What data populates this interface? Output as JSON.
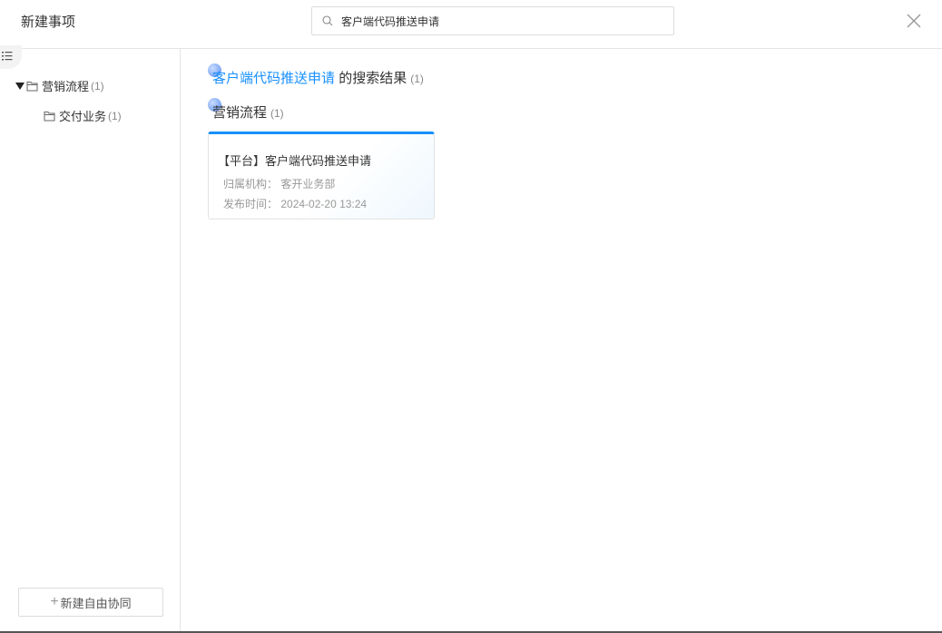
{
  "header": {
    "title": "新建事项",
    "search_value": "客户端代码推送申请"
  },
  "sidebar": {
    "tree": [
      {
        "label": "营销流程",
        "count": "(1)",
        "expanded": true
      },
      {
        "label": "交付业务",
        "count": "(1)"
      }
    ],
    "new_button": "新建自由协同",
    "new_button_icon": "+"
  },
  "main": {
    "result_keyword": "客户端代码推送申请",
    "result_suffix": "的搜索结果",
    "result_count": "(1)",
    "group_label": "营销流程",
    "group_count": "(1)",
    "card": {
      "title": "【平台】客户端代码推送申请",
      "org_label": "归属机构：",
      "org_value": "客开业务部",
      "time_label": "发布时间：",
      "time_value": "2024-02-20 13:24"
    }
  },
  "colors": {
    "accent": "#1890ff"
  }
}
